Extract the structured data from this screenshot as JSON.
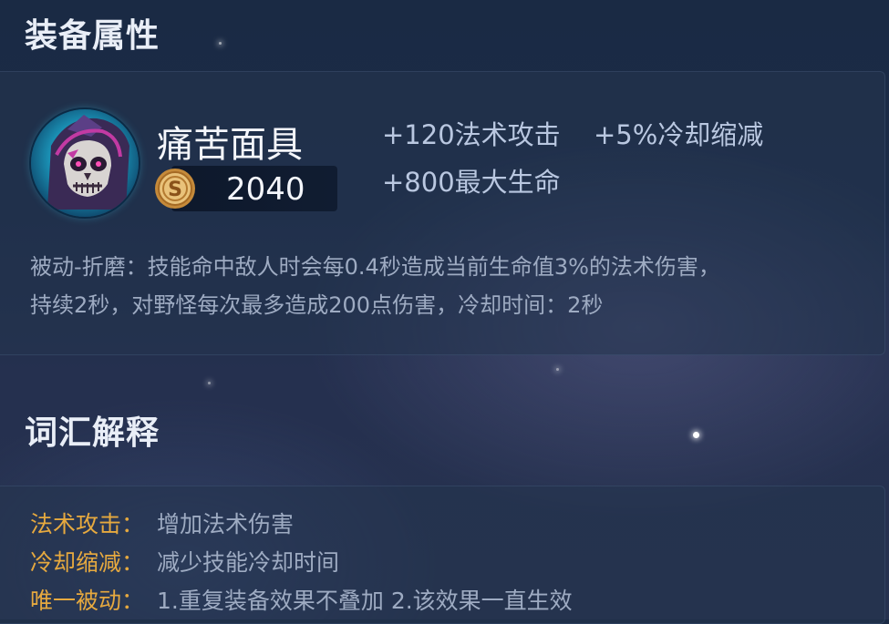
{
  "sections": {
    "equip_title": "装备属性",
    "terms_title": "词汇解释"
  },
  "item": {
    "name": "痛苦面具",
    "icon": "skull-mask-icon",
    "price": "2040",
    "coin_icon": "gold-coin-icon",
    "stats": [
      "+120法术攻击",
      "+5%冷却缩减",
      "+800最大生命"
    ],
    "passive_line1": "被动-折磨：技能命中敌人时会每0.4秒造成当前生命值3%的法术伤害，",
    "passive_line2": "持续2秒，对野怪每次最多造成200点伤害，冷却时间：2秒"
  },
  "terms": [
    {
      "key": "法术攻击",
      "value": "增加法术伤害"
    },
    {
      "key": "冷却缩减",
      "value": "减少技能冷却时间"
    },
    {
      "key": "唯一被动",
      "value": "1.重复装备效果不叠加 2.该效果一直生效"
    }
  ],
  "colors": {
    "accent_term": "#e6a93f",
    "text_primary": "#f4f6fb",
    "text_stat": "#b9c7e0",
    "text_desc": "#9eabc2"
  }
}
